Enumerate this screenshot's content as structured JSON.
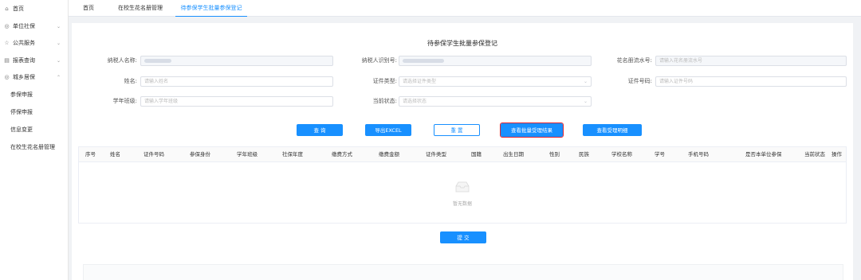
{
  "sidebar": {
    "items": [
      {
        "label": "首页",
        "icon": "home-icon",
        "glyph": "⌂",
        "expandable": false
      },
      {
        "label": "单位社保",
        "icon": "circle-icon",
        "glyph": "◎",
        "expandable": true
      },
      {
        "label": "公共服务",
        "icon": "star-icon",
        "glyph": "☆",
        "expandable": true
      },
      {
        "label": "报表查询",
        "icon": "report-icon",
        "glyph": "▤",
        "expandable": true
      },
      {
        "label": "城乡居保",
        "icon": "circle-icon",
        "glyph": "◎",
        "expandable": true,
        "expanded": true
      }
    ],
    "subitems": [
      "参保申报",
      "停保申报",
      "信息变更",
      "在校生花名册管理"
    ]
  },
  "tabs": [
    {
      "label": "首页",
      "active": false
    },
    {
      "label": "在校生花名册管理",
      "active": false
    },
    {
      "label": "待参保学生批量参保登记",
      "active": true
    }
  ],
  "form": {
    "title": "待参保学生批量参保登记",
    "fields": {
      "taxpayer_name": {
        "label": "纳税人名称:",
        "placeholder": ""
      },
      "taxpayer_id": {
        "label": "纳税人识别号:",
        "placeholder": ""
      },
      "roster_no": {
        "label": "花名册流水号:",
        "placeholder": "请输入花名册流水号"
      },
      "name": {
        "label": "姓名:",
        "placeholder": "请输入姓名"
      },
      "cert_type": {
        "label": "证件类型:",
        "placeholder": "请选择证件类型"
      },
      "cert_no": {
        "label": "证件号码:",
        "placeholder": "请输入证件号码"
      },
      "class": {
        "label": "学年班级:",
        "placeholder": "请输入学年班级"
      },
      "status": {
        "label": "当前状态:",
        "placeholder": "请选择状态"
      }
    }
  },
  "buttons": {
    "query": "查 询",
    "export": "导出EXCEL",
    "reset": "重 置",
    "view_result": "查看批量受理结果",
    "view_detail": "查看受理明细",
    "submit": "提 交"
  },
  "table": {
    "columns": [
      "序号",
      "姓名",
      "证件号码",
      "参保身份",
      "学年班级",
      "社保年度",
      "缴费方式",
      "缴费金额",
      "证件类型",
      "国籍",
      "出生日期",
      "性别",
      "民族",
      "学校名称",
      "学号",
      "手机号码",
      "是否本单位参保",
      "当前状态",
      "操作"
    ],
    "empty_text": "暂无数据"
  },
  "colors": {
    "primary": "#1890ff",
    "highlight_border": "#e0242f"
  }
}
